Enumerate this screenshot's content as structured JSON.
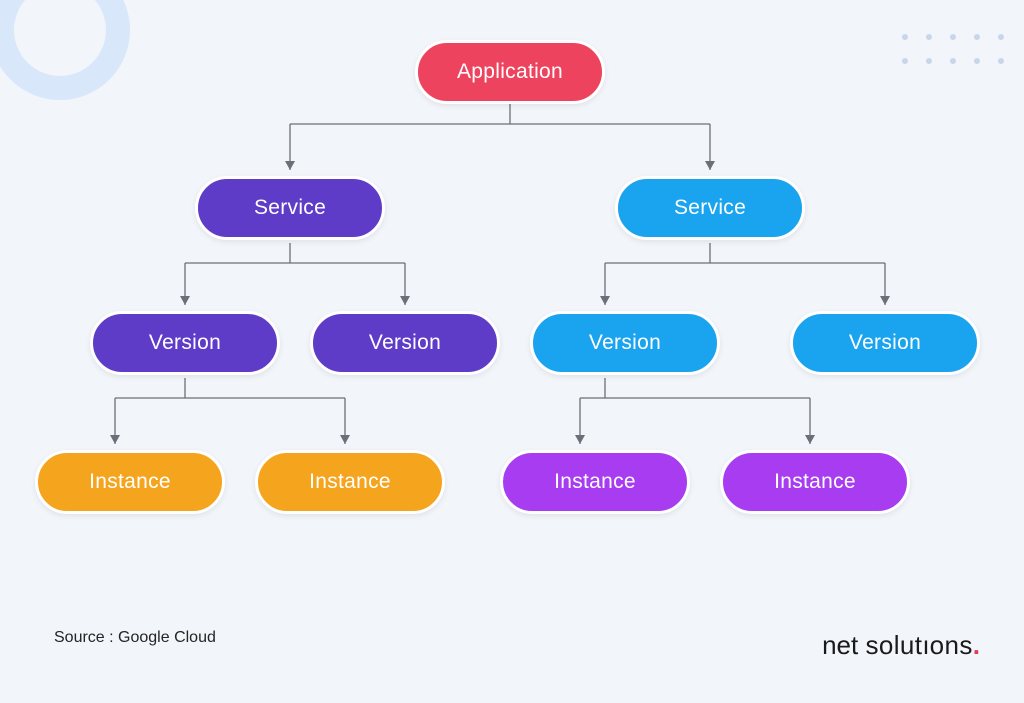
{
  "nodes": {
    "application": {
      "label": "Application"
    },
    "service_left": {
      "label": "Service"
    },
    "service_right": {
      "label": "Service"
    },
    "version_1": {
      "label": "Version"
    },
    "version_2": {
      "label": "Version"
    },
    "version_3": {
      "label": "Version"
    },
    "version_4": {
      "label": "Version"
    },
    "instance_1": {
      "label": "Instance"
    },
    "instance_2": {
      "label": "Instance"
    },
    "instance_3": {
      "label": "Instance"
    },
    "instance_4": {
      "label": "Instance"
    }
  },
  "colors": {
    "application": "#ee435f",
    "service_left": "#5e3cc7",
    "service_right": "#1aa3ef",
    "version_left": "#5e3cc7",
    "version_right": "#1aa3ef",
    "instance_left": "#f5a41e",
    "instance_right": "#a83cf0"
  },
  "footer": {
    "source": "Source : Google Cloud",
    "logo_net": "net",
    "logo_solutions": "solut",
    "logo_tail": "ons"
  }
}
